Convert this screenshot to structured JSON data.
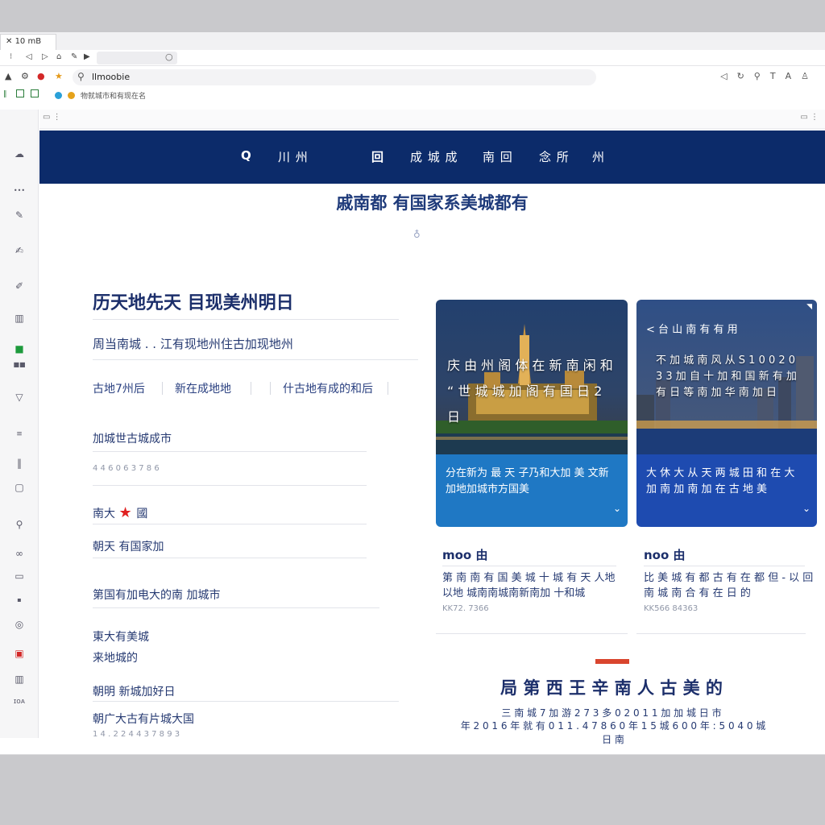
{
  "browser": {
    "tab_title": "10 mB",
    "address": "llmoobie",
    "bookmark_text": "物就城市和有现在名"
  },
  "nav": {
    "items": [
      "Q",
      "川 州",
      "回",
      "成 城 成",
      "南 回",
      "念 所",
      "州"
    ]
  },
  "site_title": "戚南都 有国家系美城都有",
  "left_column": {
    "heading": "历天地先天  目现美州明日",
    "line1": "周当南城 . . 江有现地州住古加现地州",
    "links": [
      "古地7州后",
      "新在成地地",
      "什古地有成的和后"
    ],
    "item_a": "加城世古城成市",
    "item_a_sub": "4 4 6 0 6 3 7 8 6",
    "star_row_left": "南大",
    "star_row_right": "國",
    "item_c": "朝天 有国家加",
    "item_d": "第国有加电大的南 加城市",
    "item_e1": "東大有美城",
    "item_e2": "来地城的",
    "item_f": "朝明  新城加好日",
    "item_g": "朝广大古有片城大国",
    "item_g_sub": "1 4 . 2 2 4 4 3 7 8 9 3"
  },
  "cards": [
    {
      "caption1": "庆 由 州 阁 体 在 新 南 闲 和",
      "caption2": "“ 世 城 城 加 阁 有 国 日 2 日",
      "footer": "分在新为 最  天 子乃和大加 美 文新加地加城市方国美",
      "meta_title": "moo 由",
      "meta_text": "第 南 南 有 国 美 城 十 城 有 天 人地以地 城南南城南新南加 十和城",
      "meta_sub": "KK72. 7366"
    },
    {
      "top": "< 台 山 南 有   有 用",
      "caption": "不 加 城 南 风 从 S 1 0 0 2 0 3 3 加 自 十 加 和 国 新 有 加 有 日 等 南 加 华 南 加 日",
      "footer": "大 休 大 从 天  两 城 田  和 在 大 加 南 加 南 加 在 古 地 美",
      "meta_title": "noo 由",
      "meta_text": "比 美 城 有 都 古 有 在 都 但 - 以 回 南 城 南 合 有 在 日 的",
      "meta_sub": "KK566 84363"
    }
  ],
  "bottom": {
    "heading": "局 第 西  王 辛 南 人 古 美 的",
    "line1": "三 南 城 7 加 游 2 7 3 多 0 2 0 1 1 加 加 城 日 市",
    "line2": "年 2 0 1 6 年 就 有 0 1 1 . 4 7 8 6 0 年 1 5 城 6 0 0 年 : 5 0 4 0 城 日 南"
  },
  "colors": {
    "nav_bg": "#0c2b6a",
    "accent_red": "#d9452e",
    "card1_footer": "#1f78c4",
    "card2_footer": "#1e4bb0"
  }
}
